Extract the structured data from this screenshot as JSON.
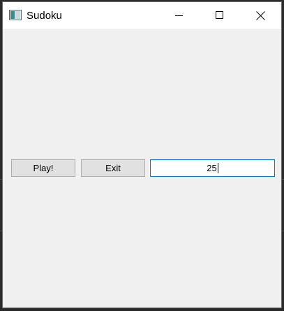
{
  "window": {
    "title": "Sudoku",
    "icons": {
      "app": "app-window-icon",
      "minimize": "minimize-icon",
      "maximize": "maximize-icon",
      "close": "close-icon"
    }
  },
  "controls": {
    "play_label": "Play!",
    "exit_label": "Exit",
    "number_value": "25"
  }
}
